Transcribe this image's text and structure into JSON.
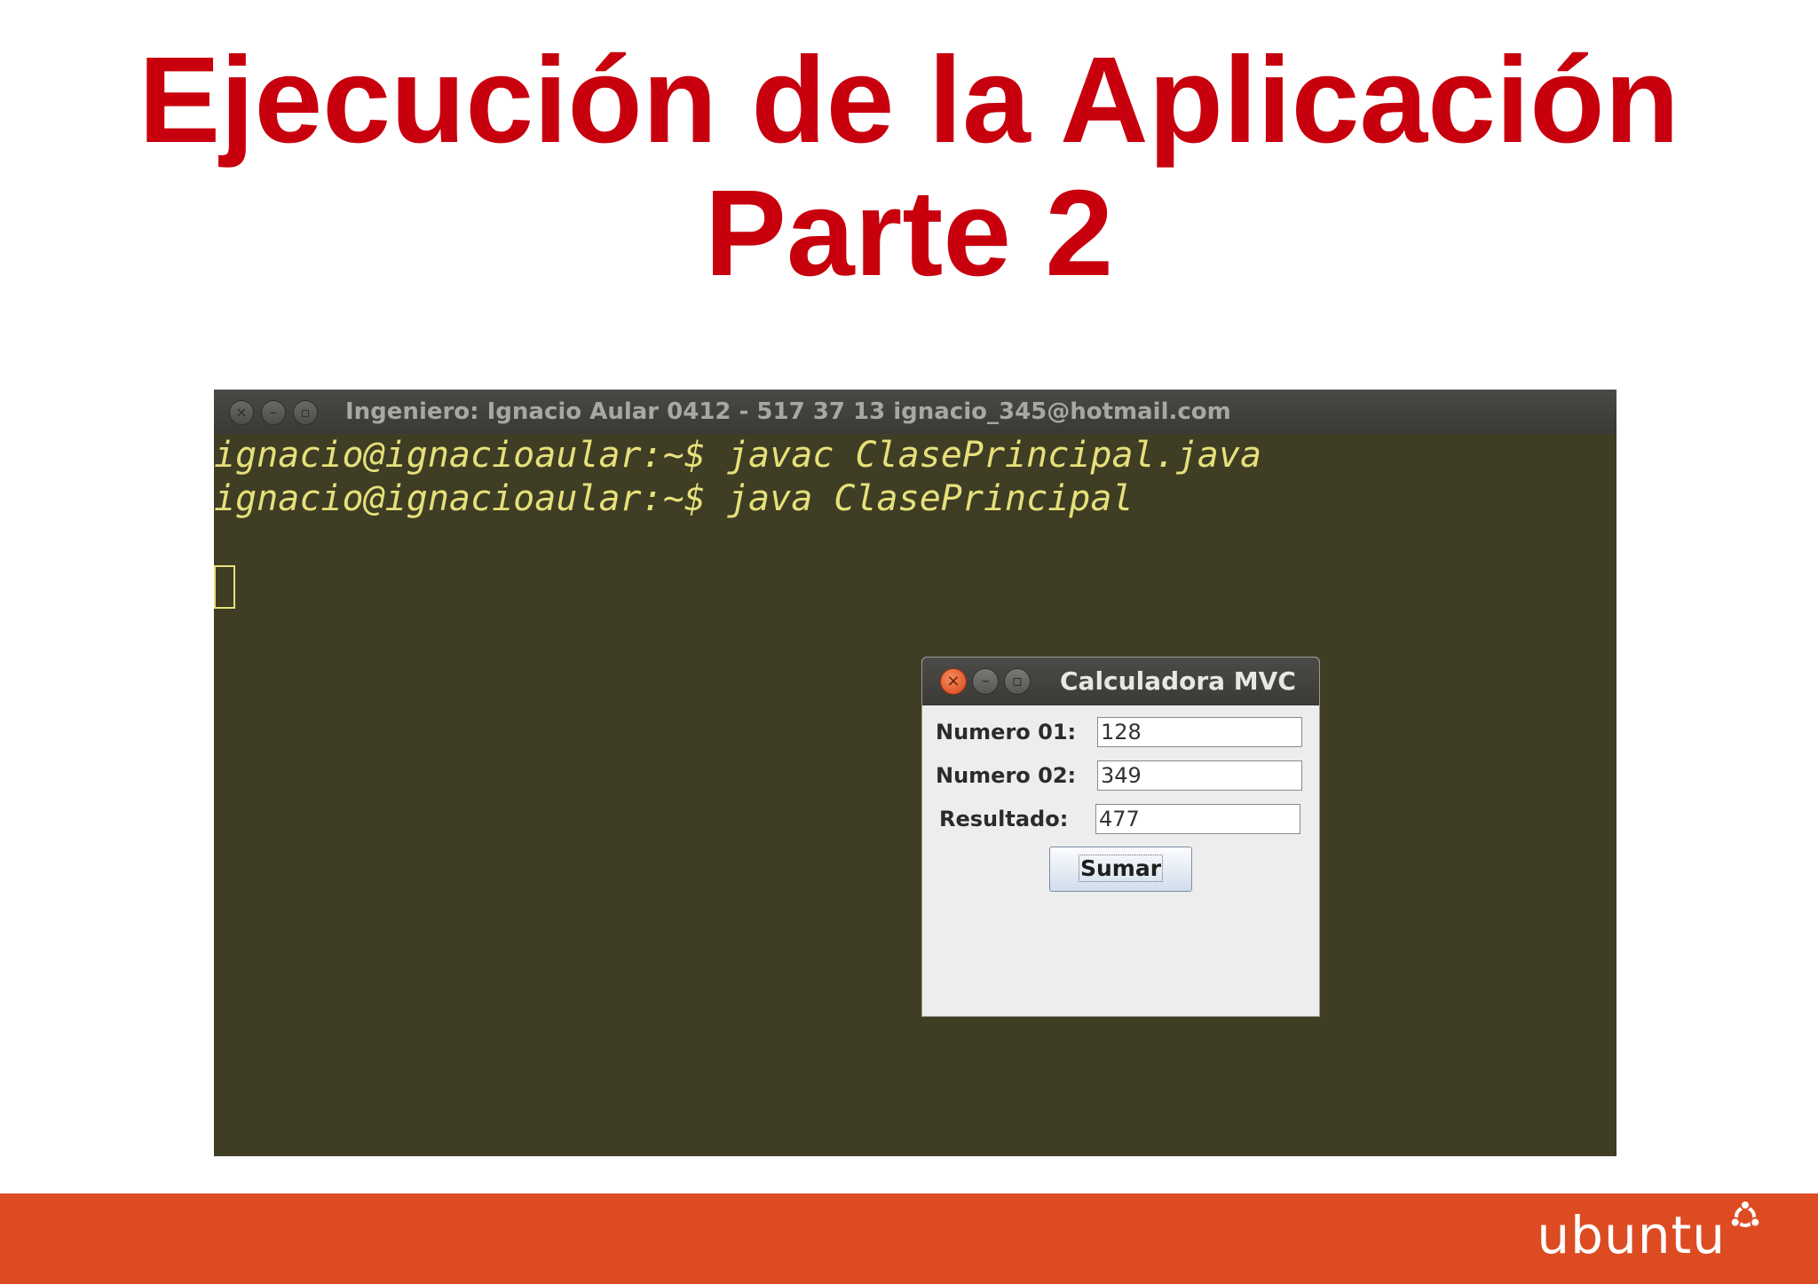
{
  "slide": {
    "title_line1": "Ejecución de la Aplicación",
    "title_line2": "Parte 2"
  },
  "terminal": {
    "title": "Ingeniero: Ignacio Aular  0412 - 517 37 13 ignacio_345@hotmail.com",
    "lines": [
      "ignacio@ignacioaular:~$ javac ClasePrincipal.java",
      "ignacio@ignacioaular:~$ java ClasePrincipal"
    ],
    "window_buttons": [
      "close-icon",
      "minimize-icon",
      "maximize-icon"
    ]
  },
  "calculator": {
    "title": "Calculadora MVC",
    "fields": [
      {
        "label": "Numero 01:",
        "value": "128"
      },
      {
        "label": "Numero 02:",
        "value": "349"
      },
      {
        "label": "Resultado:",
        "value": "477"
      }
    ],
    "button_label": "Sumar"
  },
  "footer": {
    "logo_text": "ubuntu",
    "band_color": "#dd4b22"
  },
  "colors": {
    "title_red": "#c8000e",
    "terminal_bg": "#3f3d24",
    "terminal_text": "#e6e07a"
  }
}
